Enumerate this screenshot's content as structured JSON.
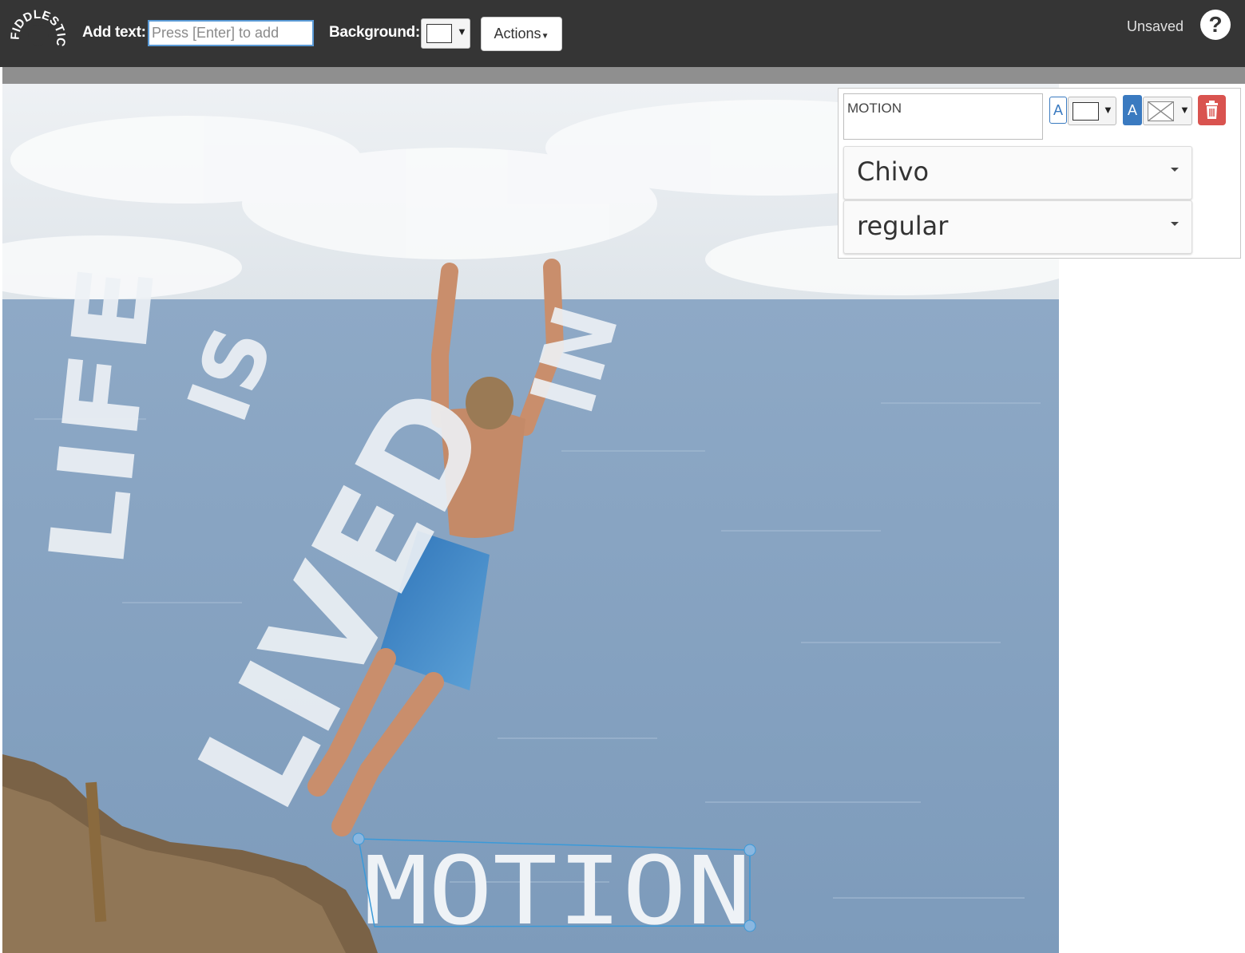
{
  "toolbar": {
    "logo_text": "FIDDLESTICKS",
    "add_text_label": "Add text:",
    "add_text_placeholder": "Press [Enter] to add",
    "add_text_value": "",
    "background_label": "Background:",
    "background_color": "#ffffff",
    "actions_label": "Actions",
    "status": "Unsaved",
    "help_label": "?"
  },
  "canvas": {
    "text_items": [
      "LIFE",
      "IS",
      "LIVED",
      "IN",
      "MOTION"
    ],
    "selected_text": "MOTION"
  },
  "panel": {
    "text_value": "MOTION",
    "text_color_letter": "A",
    "text_color": "#ffffff",
    "text_bg_letter": "A",
    "text_bg_color": "transparent",
    "font": "Chivo",
    "weight": "regular"
  },
  "colors": {
    "toolbar_bg": "#353535",
    "accent_blue": "#3a7ac0",
    "delete_red": "#d9534f"
  }
}
